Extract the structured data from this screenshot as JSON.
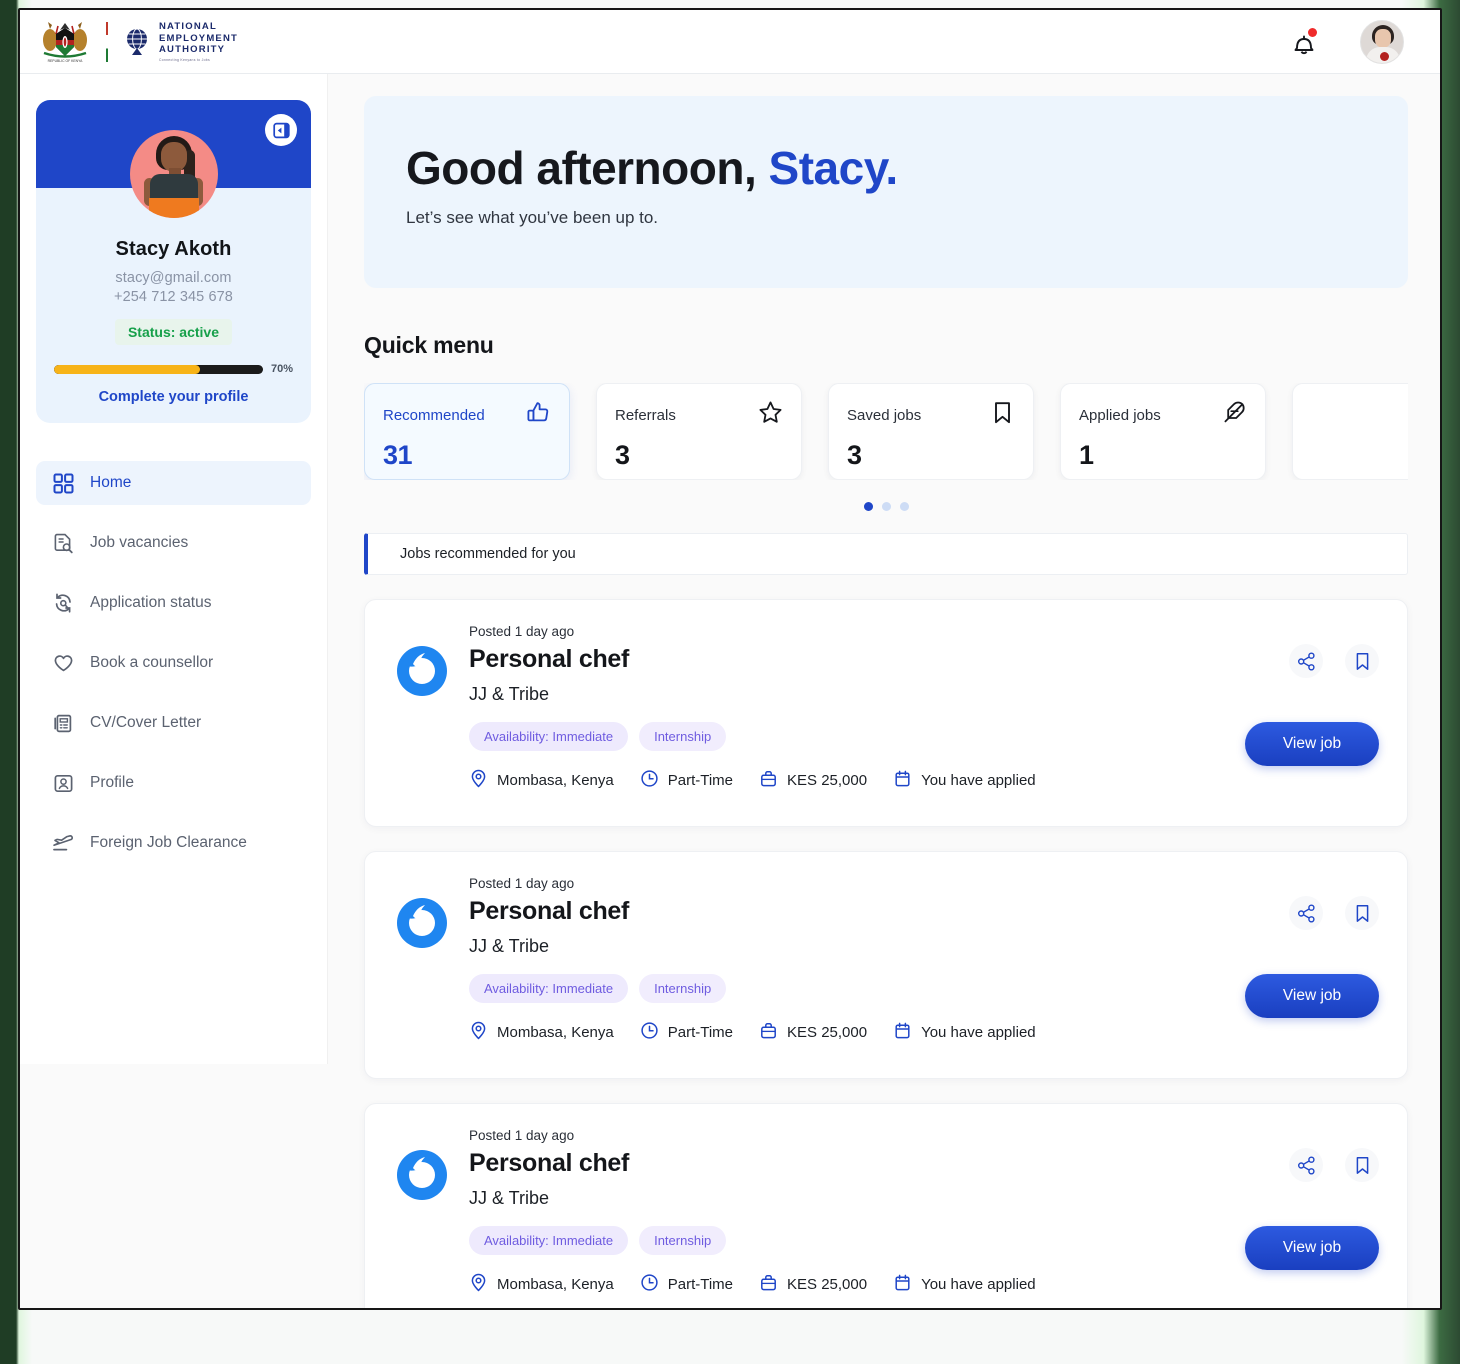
{
  "topbar": {
    "coat_of_arms_alt": "Republic of Kenya Coat of Arms",
    "coat_caption": "REPUBLIC OF KENYA",
    "org_line1": "NATIONAL",
    "org_line2": "EMPLOYMENT",
    "org_line3": "AUTHORITY",
    "org_tagline": "Connecting Kenyans to Jobs",
    "bell_label": "Notifications",
    "avatar_label": "Account"
  },
  "profile": {
    "name": "Stacy Akoth",
    "email": "stacy@gmail.com",
    "phone": "+254 712 345 678",
    "status": "Status: active",
    "progress_pct": "70%",
    "progress_value": 70,
    "complete_link": "Complete your profile",
    "toggle_label": "Collapse sidebar"
  },
  "sidebar": {
    "items": [
      {
        "label": "Home",
        "icon": "grid-icon",
        "active": true
      },
      {
        "label": "Job vacancies",
        "icon": "document-search-icon",
        "active": false
      },
      {
        "label": "Application status",
        "icon": "refresh-search-icon",
        "active": false
      },
      {
        "label": "Book a counsellor",
        "icon": "heart-icon",
        "active": false
      },
      {
        "label": "CV/Cover Letter",
        "icon": "document-list-icon",
        "active": false
      },
      {
        "label": "Profile",
        "icon": "id-card-icon",
        "active": false
      },
      {
        "label": "Foreign Job Clearance",
        "icon": "airplane-icon",
        "active": false
      }
    ]
  },
  "hero": {
    "greeting": "Good afternoon,",
    "name": "Stacy.",
    "subtitle": "Let’s see what you’ve been up to."
  },
  "quick_menu": {
    "title": "Quick menu",
    "cards": [
      {
        "label": "Recommended",
        "value": "31",
        "icon": "thumbs-up-icon",
        "selected": true
      },
      {
        "label": "Referrals",
        "value": "3",
        "icon": "star-icon",
        "selected": false
      },
      {
        "label": "Saved jobs",
        "value": "3",
        "icon": "bookmark-icon",
        "selected": false
      },
      {
        "label": "Applied jobs",
        "value": "1",
        "icon": "feather-icon",
        "selected": false
      }
    ],
    "dots": [
      true,
      false,
      false
    ]
  },
  "recommended": {
    "header": "Jobs recommended for you",
    "jobs": [
      {
        "posted": "Posted 1 day ago",
        "title": "Personal chef",
        "company": "JJ & Tribe",
        "tags": [
          "Availability: Immediate",
          "Internship"
        ],
        "location": "Mombasa, Kenya",
        "type": "Part-Time",
        "salary": "KES 25,000",
        "applied": "You have applied",
        "view_label": "View job",
        "share_label": "Share",
        "save_label": "Save job"
      },
      {
        "posted": "Posted 1 day ago",
        "title": "Personal chef",
        "company": "JJ & Tribe",
        "tags": [
          "Availability: Immediate",
          "Internship"
        ],
        "location": "Mombasa, Kenya",
        "type": "Part-Time",
        "salary": "KES 25,000",
        "applied": "You have applied",
        "view_label": "View job",
        "share_label": "Share",
        "save_label": "Save job"
      },
      {
        "posted": "Posted 1 day ago",
        "title": "Personal chef",
        "company": "JJ & Tribe",
        "tags": [
          "Availability: Immediate",
          "Internship"
        ],
        "location": "Mombasa, Kenya",
        "type": "Part-Time",
        "salary": "KES 25,000",
        "applied": "You have applied",
        "view_label": "View job",
        "share_label": "Share",
        "save_label": "Save job"
      }
    ]
  },
  "colors": {
    "brand_blue": "#1f46c8",
    "hero_bg": "#edf5fd",
    "status_green": "#16a04a",
    "progress_orange": "#f7b318",
    "tag_purple": "#6f5ce0",
    "notification_red": "#ef2b2b"
  }
}
